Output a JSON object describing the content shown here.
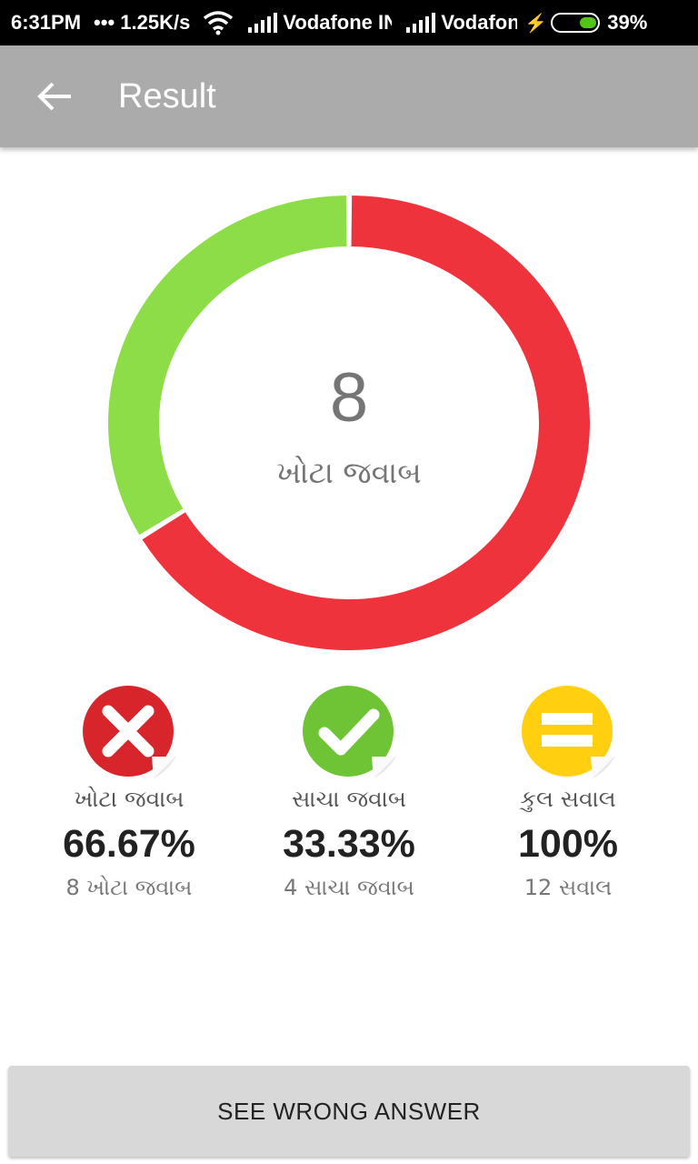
{
  "status_bar": {
    "time": "6:31PM",
    "speed": "••• 1.25K/s",
    "carrier1": "Vodafone IN",
    "carrier2": "Vodafone IN",
    "battery": "39%",
    "battery_level": 0.39
  },
  "app_bar": {
    "title": "Result",
    "back_icon": "arrow-back-icon"
  },
  "chart_data": {
    "type": "pie",
    "labels": [
      "ખોટા જવાબ",
      "સાચા જવાબ"
    ],
    "values": [
      8,
      4
    ],
    "colors": [
      "#ef333c",
      "#8ddd49"
    ],
    "center_value": "8",
    "center_label": "ખોટા જવાબ"
  },
  "stats": [
    {
      "icon": "wrong-cross-icon",
      "label": "ખોટા જવાબ",
      "percent": "66.67%",
      "sub": "8 ખોટા જવાબ",
      "color": "#d8252c"
    },
    {
      "icon": "correct-check-icon",
      "label": "સાચા જવાબ",
      "percent": "33.33%",
      "sub": "4 સાચા જવાબ",
      "color": "#6ec435"
    },
    {
      "icon": "total-equals-icon",
      "label": "કુલ સવાલ",
      "percent": "100%",
      "sub": "12 સવાલ",
      "color": "#ffcf10"
    }
  ],
  "button": {
    "label": "SEE WRONG ANSWER"
  }
}
